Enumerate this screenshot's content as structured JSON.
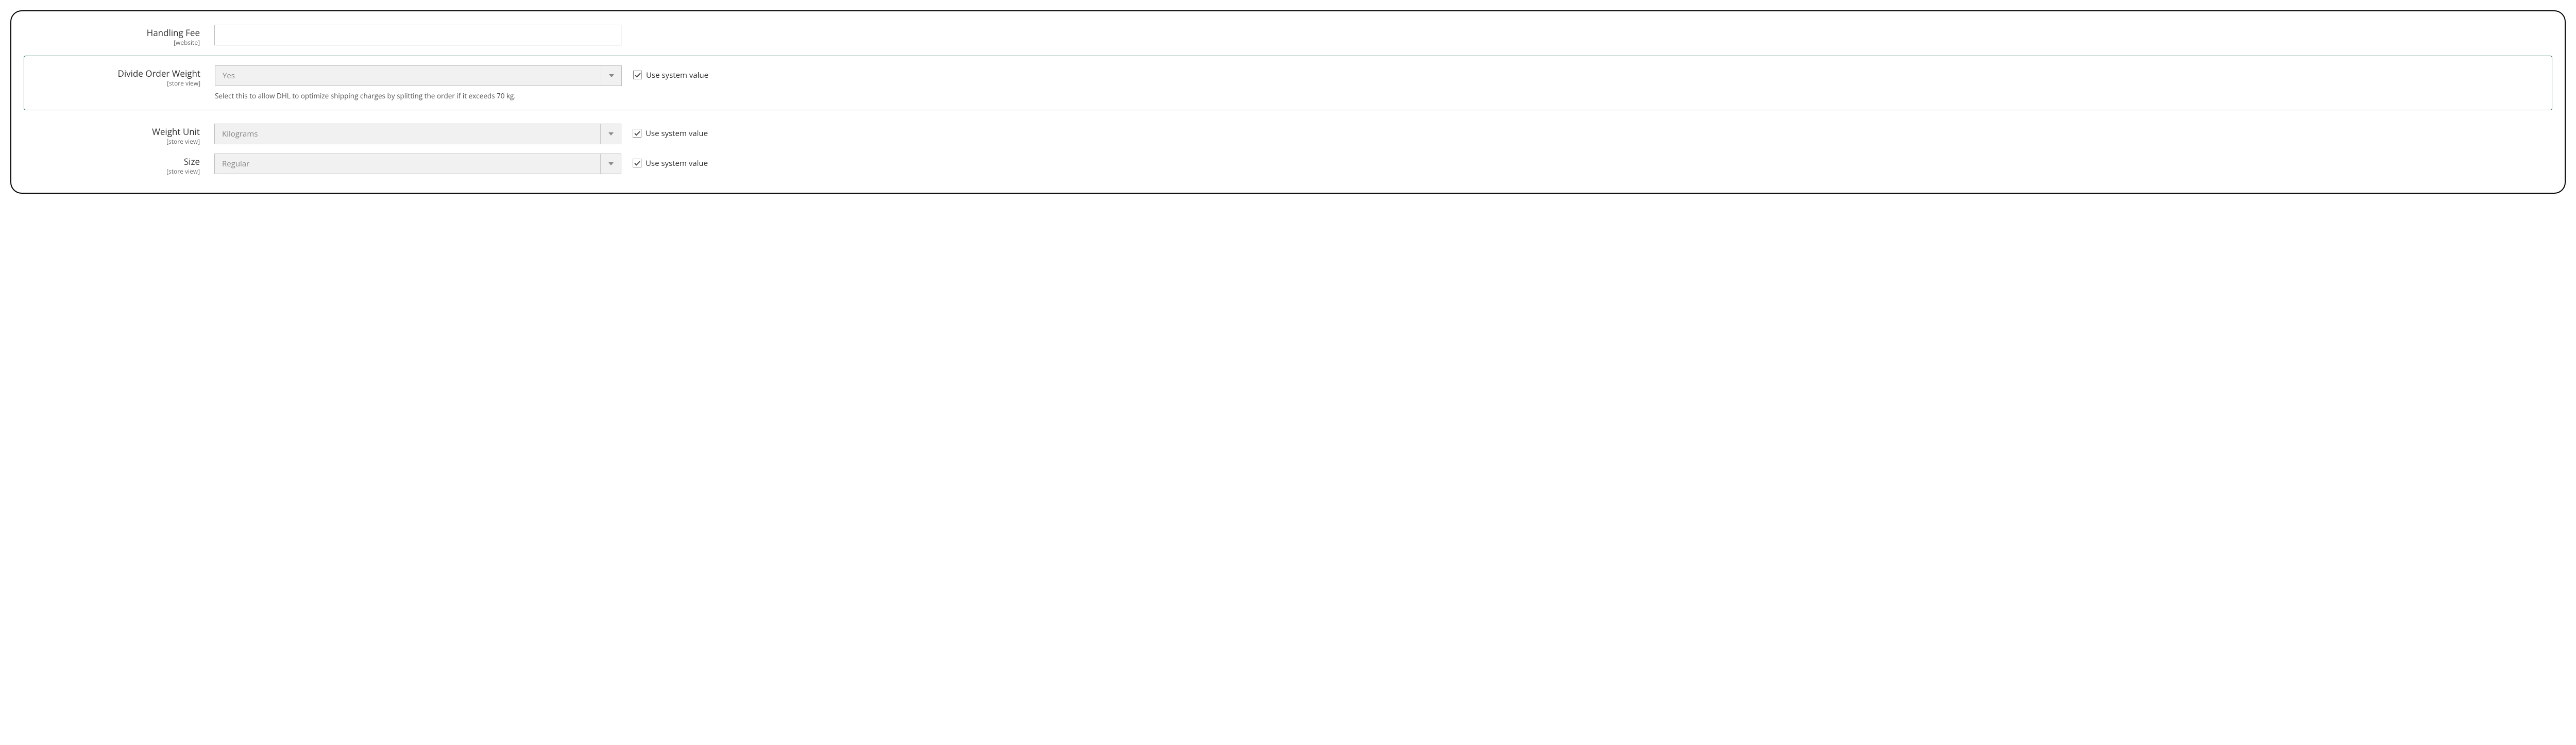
{
  "colors": {
    "highlight_border": "#3a7a62",
    "check_color": "#514943"
  },
  "checkbox_label": "Use system value",
  "fields": {
    "handling_fee": {
      "label": "Handling Fee",
      "scope": "[website]",
      "value": ""
    },
    "divide_order_weight": {
      "label": "Divide Order Weight",
      "scope": "[store view]",
      "value": "Yes",
      "hint": "Select this to allow DHL to optimize shipping charges by splitting the order if it exceeds 70 kg.",
      "use_system_value": true
    },
    "weight_unit": {
      "label": "Weight Unit",
      "scope": "[store view]",
      "value": "Kilograms",
      "use_system_value": true
    },
    "size": {
      "label": "Size",
      "scope": "[store view]",
      "value": "Regular",
      "use_system_value": true
    }
  }
}
